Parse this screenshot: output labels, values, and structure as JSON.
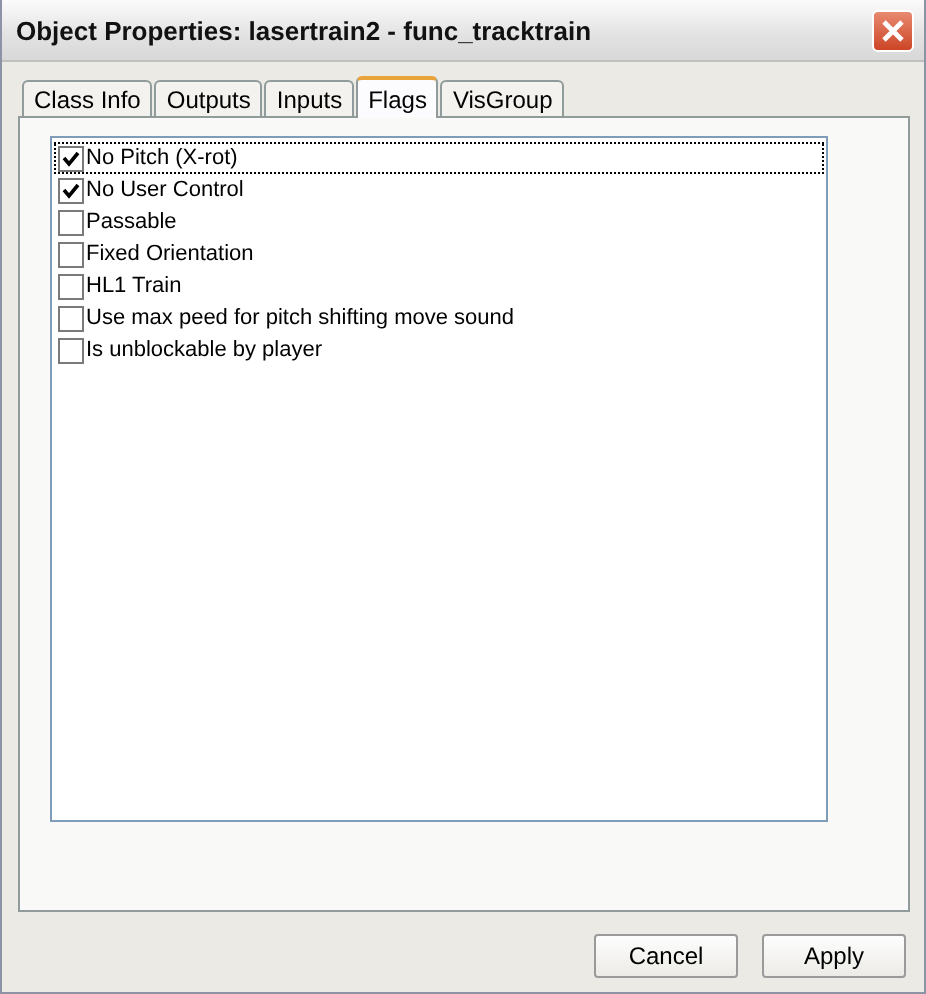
{
  "window": {
    "title": "Object Properties: lasertrain2 - func_tracktrain"
  },
  "tabs": [
    {
      "label": "Class Info",
      "selected": false
    },
    {
      "label": "Outputs",
      "selected": false
    },
    {
      "label": "Inputs",
      "selected": false
    },
    {
      "label": "Flags",
      "selected": true
    },
    {
      "label": "VisGroup",
      "selected": false
    }
  ],
  "flags": [
    {
      "label": "No Pitch (X-rot)",
      "checked": true,
      "focused": true
    },
    {
      "label": "No User Control",
      "checked": true,
      "focused": false
    },
    {
      "label": "Passable",
      "checked": false,
      "focused": false
    },
    {
      "label": "Fixed Orientation",
      "checked": false,
      "focused": false
    },
    {
      "label": "HL1 Train",
      "checked": false,
      "focused": false
    },
    {
      "label": "Use max peed for pitch shifting move sound",
      "checked": false,
      "focused": false
    },
    {
      "label": "Is unblockable by player",
      "checked": false,
      "focused": false
    }
  ],
  "buttons": [
    "Cancel",
    "Apply"
  ]
}
